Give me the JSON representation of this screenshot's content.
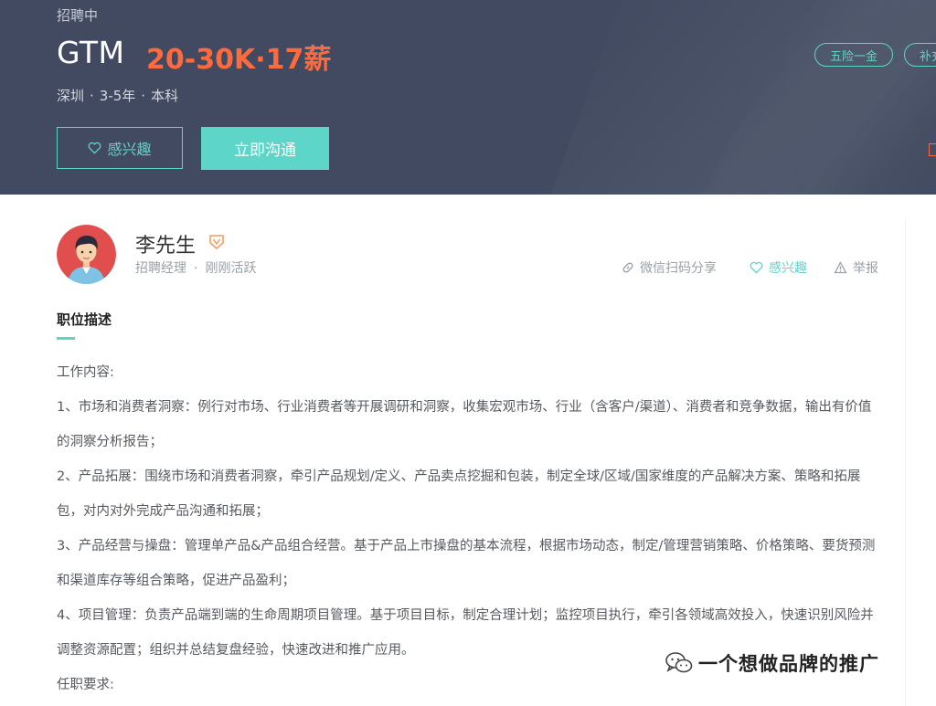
{
  "header": {
    "status": "招聘中",
    "job_title": "GTM",
    "salary": "20-30K·17薪",
    "meta": {
      "location": "深圳",
      "experience": "3-5年",
      "education": "本科",
      "dot": "·"
    },
    "interest_button": "感兴趣",
    "chat_button": "立即沟通",
    "tags": [
      "五险一金",
      "补充"
    ]
  },
  "recruiter": {
    "name": "李先生",
    "role": "招聘经理",
    "separator": "·",
    "activity": "刚刚活跃"
  },
  "actions": {
    "share": "微信扫码分享",
    "interest": "感兴趣",
    "report": "举报"
  },
  "description": {
    "title": "职位描述",
    "paragraphs": [
      "工作内容:",
      "1、市场和消费者洞察：例行对市场、行业消费者等开展调研和洞察，收集宏观市场、行业（含客户/渠道）、消费者和竞争数据，输出有价值的洞察分析报告；",
      "2、产品拓展：围绕市场和消费者洞察，牵引产品规划/定义、产品卖点挖掘和包装，制定全球/区域/国家维度的产品解决方案、策略和拓展包，对内对外完成产品沟通和拓展；",
      "3、产品经营与操盘：管理单产品&产品组合经营。基于产品上市操盘的基本流程，根据市场动态，制定/管理营销策略、价格策略、要货预测和渠道库存等组合策略，促进产品盈利；",
      "4、项目管理：负责产品端到端的生命周期项目管理。基于项目目标，制定合理计划；监控项目执行，牵引各领域高效投入，快速识别风险并调整资源配置；组织并总结复盘经验，快速改进和推广应用。",
      "任职要求:"
    ]
  },
  "watermark": {
    "text": "一个想做品牌的推广"
  },
  "colors": {
    "banner": "#414a60",
    "accent": "#5dd5c8",
    "salary": "#ff6a3d"
  }
}
